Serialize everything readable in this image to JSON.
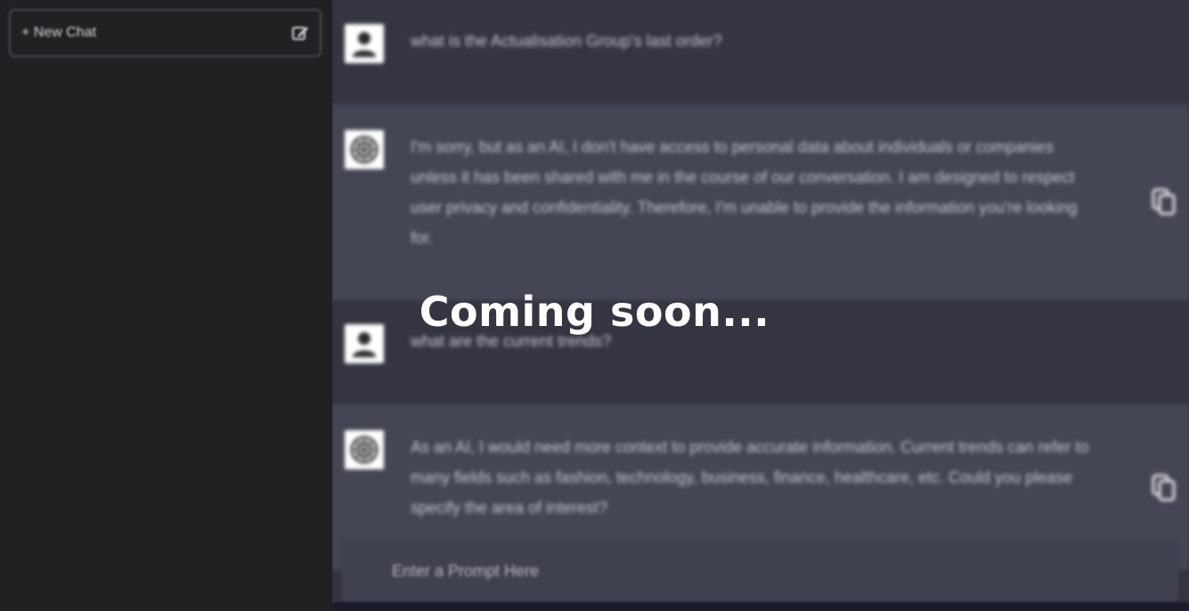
{
  "sidebar": {
    "new_chat_label": "+ New Chat",
    "new_chat_icon": "edit-icon"
  },
  "conversation": [
    {
      "role": "user",
      "avatar_icon": "user-icon",
      "text": "what is the Actualisation Group's last order?"
    },
    {
      "role": "assistant",
      "avatar_icon": "ai-logo-icon",
      "text": "I'm sorry, but as an AI, I don't have access to personal data about individuals or companies unless it has been shared with me in the course of our conversation. I am designed to respect user privacy and confidentiality. Therefore, I'm unable to provide the information you're looking for.",
      "action_icon": "copy-icon"
    },
    {
      "role": "user",
      "avatar_icon": "user-icon",
      "text": "what are the current trends?"
    },
    {
      "role": "assistant",
      "avatar_icon": "ai-logo-icon",
      "text": "As an AI, I would need more context to provide accurate information. Current trends can refer to many fields such as fashion, technology, business, finance, healthcare, etc. Could you please specify the area of interest?",
      "action_icon": "copy-icon"
    }
  ],
  "prompt": {
    "placeholder": "Enter a Prompt Here",
    "value": ""
  },
  "overlay": {
    "text": "Coming soon..."
  },
  "colors": {
    "sidebar_bg": "#202123",
    "user_msg_bg": "#343541",
    "assistant_msg_bg": "#444654",
    "text": "#c5c5d2",
    "overlay_text": "#ffffff"
  }
}
